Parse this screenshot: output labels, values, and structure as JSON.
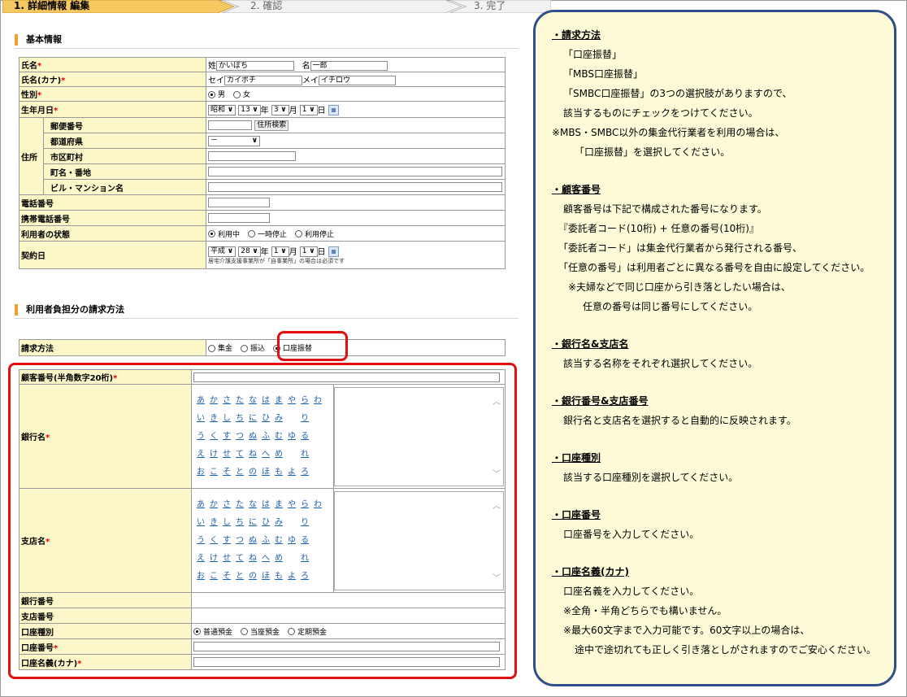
{
  "steps": [
    "1. 詳細情報 編集",
    "2. 確認",
    "3. 完了"
  ],
  "sections": {
    "basic": "基本情報",
    "billing": "利用者負担分の請求方法"
  },
  "basic": {
    "name_label": "氏名",
    "name_sei": "姓",
    "name_sei_val": "かいぽち",
    "name_mei": "名",
    "name_mei_val": "一郎",
    "kana_label": "氏名(カナ)",
    "kana_sei": "セイ",
    "kana_sei_val": "カイポチ",
    "kana_mei": "メイ",
    "kana_mei_val": "イチロウ",
    "gender_label": "性別",
    "gender_male": "男",
    "gender_female": "女",
    "birth_label": "生年月日",
    "birth_era": "昭和",
    "birth_year": "13",
    "nen": "年",
    "birth_month": "3",
    "tsuki": "月",
    "birth_day": "1",
    "hi": "日",
    "addr_label": "住所",
    "postal_label": "郵便番号",
    "postal_btn": "住所検索",
    "pref_label": "都道府県",
    "pref_val": "－",
    "city_label": "市区町村",
    "street_label": "町名・番地",
    "bldg_label": "ビル・マンション名",
    "tel_label": "電話番号",
    "mobile_label": "携帯電話番号",
    "status_label": "利用者の状態",
    "status_opts": [
      "利用中",
      "一時停止",
      "利用停止"
    ],
    "contract_label": "契約日",
    "contract_era": "平成",
    "contract_year": "28",
    "contract_month": "1",
    "contract_day": "1",
    "contract_note": "居宅介護支援事業所が「自事業所」の場合は必須です",
    "required_mark": "*"
  },
  "billing": {
    "method_label": "請求方法",
    "methods": [
      "集金",
      "振込",
      "口座振替"
    ],
    "customer_no_label": "顧客番号(半角数字20桁)",
    "bank_label": "銀行名",
    "branch_label": "支店名",
    "kana_rows": [
      [
        "あ",
        "か",
        "さ",
        "た",
        "な",
        "は",
        "ま",
        "や",
        "ら",
        "わ"
      ],
      [
        "い",
        "き",
        "し",
        "ち",
        "に",
        "ひ",
        "み",
        "",
        "り",
        ""
      ],
      [
        "う",
        "く",
        "す",
        "つ",
        "ぬ",
        "ふ",
        "む",
        "ゆ",
        "る",
        ""
      ],
      [
        "え",
        "け",
        "せ",
        "て",
        "ね",
        "へ",
        "め",
        "",
        "れ",
        ""
      ],
      [
        "お",
        "こ",
        "そ",
        "と",
        "の",
        "ほ",
        "も",
        "よ",
        "ろ",
        ""
      ]
    ],
    "bank_no_label": "銀行番号",
    "branch_no_label": "支店番号",
    "acct_type_label": "口座種別",
    "acct_types": [
      "普通預金",
      "当座預金",
      "定期預金"
    ],
    "acct_no_label": "口座番号",
    "acct_name_label": "口座名義(カナ)"
  },
  "note": [
    {
      "h": "・請求方法",
      "lines": [
        "「口座振替」",
        "「MBS口座振替」",
        "「SMBC口座振替」の3つの選択肢がありますので、",
        "該当するものにチェックをつけてください。",
        "※MBS・SMBC以外の集金代行業者を利用の場合は、",
        "「口座振替」を選択してください。"
      ]
    },
    {
      "h": "・顧客番号",
      "lines": [
        "顧客番号は下記で構成された番号になります。",
        "『委託者コード(10桁) + 任意の番号(10桁)』",
        "「委託者コード」は集金代行業者から発行される番号、",
        "「任意の番号」は利用者ごとに異なる番号を自由に設定してください。",
        "※夫婦などで同じ口座から引き落としたい場合は、",
        "任意の番号は同じ番号にしてください。"
      ]
    },
    {
      "h": "・銀行名&支店名",
      "lines": [
        "該当する名称をそれぞれ選択してください。"
      ]
    },
    {
      "h": "・銀行番号&支店番号",
      "lines": [
        "銀行名と支店名を選択すると自動的に反映されます。"
      ]
    },
    {
      "h": "・口座種別",
      "lines": [
        "該当する口座種別を選択してください。"
      ]
    },
    {
      "h": "・口座番号",
      "lines": [
        "口座番号を入力してください。"
      ]
    },
    {
      "h": "・口座名義(カナ)",
      "lines": [
        "口座名義を入力してください。",
        "※全角・半角どちらでも構いません。",
        "※最大60文字まで入力可能です。60文字以上の場合は、",
        "途中で途切れても正しく引き落としがされますのでご安心ください。"
      ]
    }
  ]
}
